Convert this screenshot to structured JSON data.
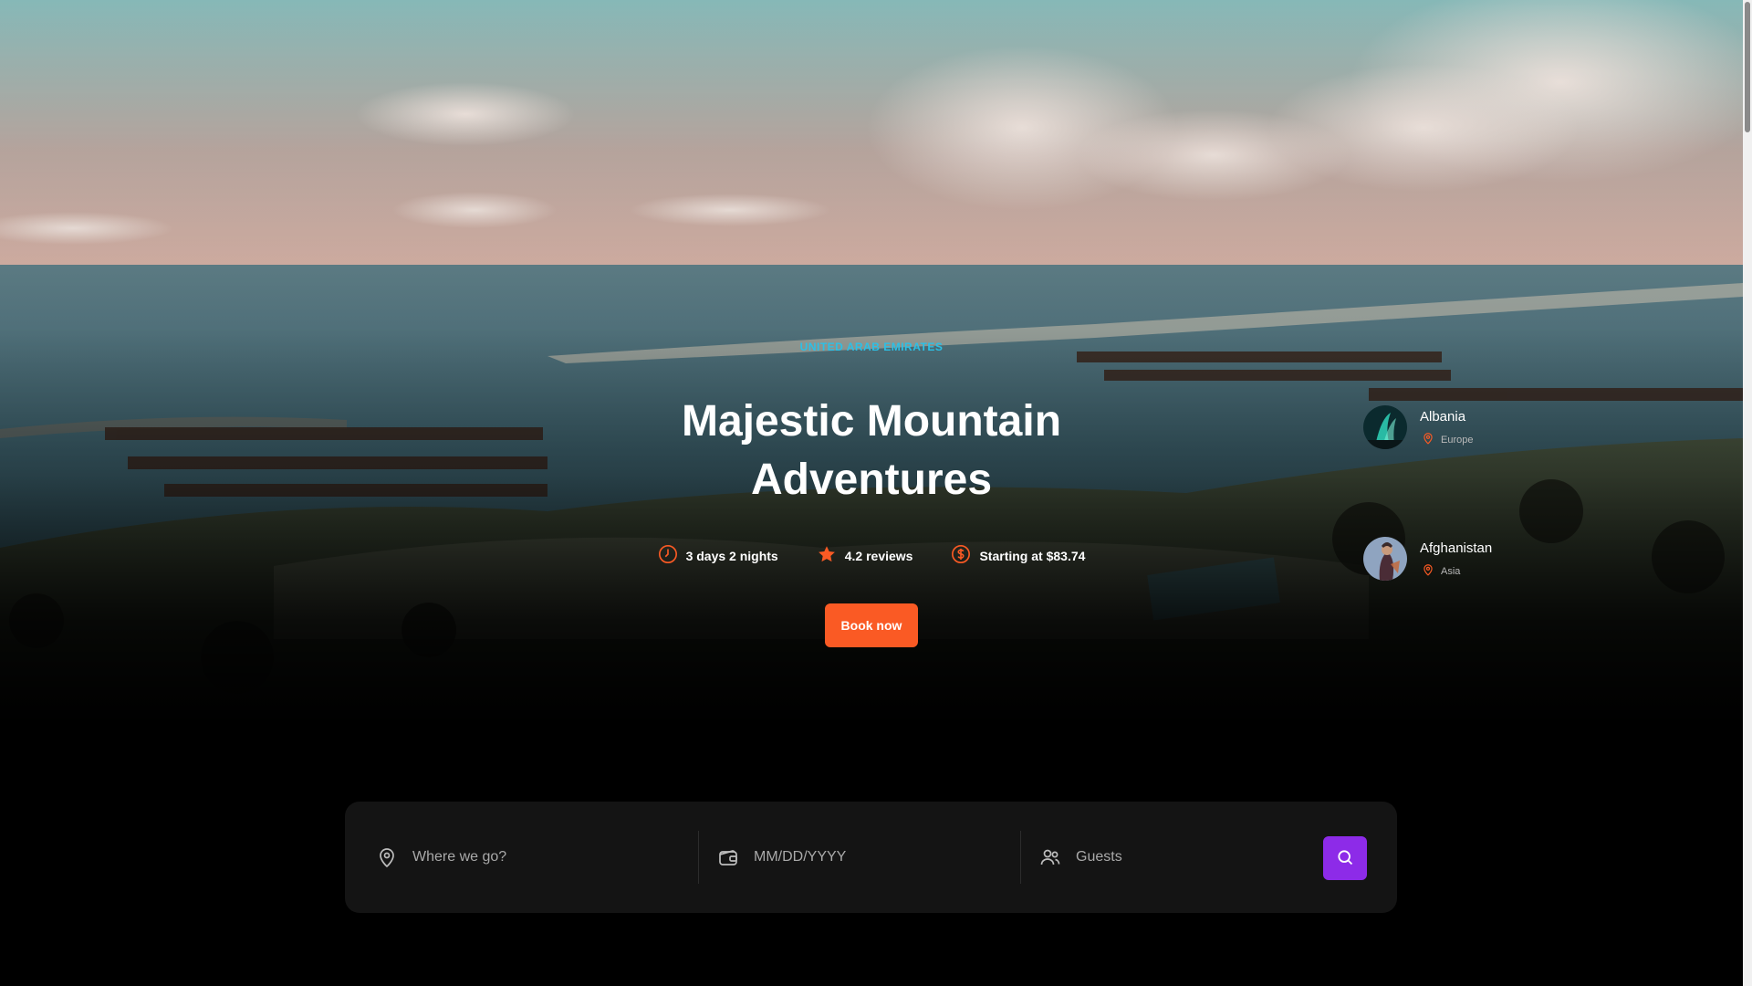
{
  "hero": {
    "country": "UNITED ARAB EMIRATES",
    "title": "Majestic Mountain Adventures",
    "meta": {
      "duration": "3 days 2 nights",
      "reviews": "4.2 reviews",
      "price": "Starting at $83.74"
    },
    "book_label": "Book now"
  },
  "destinations": [
    {
      "name": "Albania",
      "region": "Europe"
    },
    {
      "name": "Afghanistan",
      "region": "Asia"
    }
  ],
  "search": {
    "where_placeholder": "Where we go?",
    "date_placeholder": "MM/DD/YYYY",
    "guests_placeholder": "Guests"
  },
  "colors": {
    "accent_orange": "#fa5a24",
    "accent_purple": "#8d2be8",
    "accent_cyan": "#2cc0e6",
    "background": "#000000",
    "search_panel": "#141414"
  }
}
